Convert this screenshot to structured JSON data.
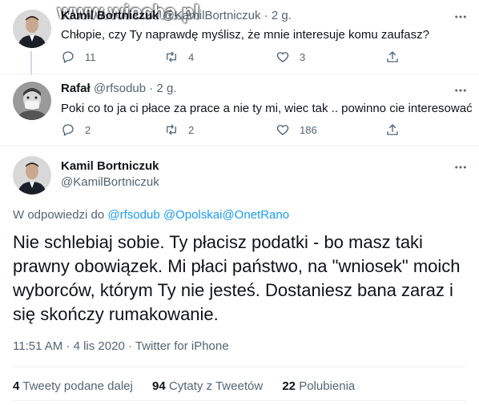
{
  "watermark": "www.wiocha.pl",
  "tweets": [
    {
      "name": "Kamil Bortniczuk",
      "handle": "@KamilBortniczuk",
      "time": "2 g.",
      "text": "Chłopie, czy Ty naprawdę myślisz, że mnie interesuje komu zaufasz?",
      "replies": "11",
      "retweets": "4",
      "likes": "3"
    },
    {
      "name": "Rafał",
      "handle": "@rfsodub",
      "time": "2 g.",
      "text": "Poki co to ja ci płace za prace a nie ty mi, wiec tak .. powinno cie interesować",
      "replies": "2",
      "retweets": "2",
      "likes": "186"
    }
  ],
  "main": {
    "name": "Kamil Bortniczuk",
    "handle": "@KamilBortniczuk",
    "reply_prefix": "W odpowiedzi do",
    "reply_targets": [
      "@rfsodub",
      "@Opolska",
      "i",
      "@OnetRano"
    ],
    "text": "Nie schlebiaj sobie. Ty płacisz podatki - bo masz taki prawny obowiązek. Mi płaci państwo, na \"wniosek\" moich wyborców, którym Ty nie jesteś. Dostaniesz bana zaraz i się skończy rumakowanie.",
    "timestamp": "11:51 AM · 4 lis 2020 · Twitter for iPhone",
    "stats": {
      "retweets_count": "4",
      "retweets_label": "Tweety podane dalej",
      "quotes_count": "94",
      "quotes_label": "Cytaty z Tweetów",
      "likes_count": "22",
      "likes_label": "Polubienia"
    }
  },
  "icons": {
    "reply": "reply-icon",
    "retweet": "retweet-icon",
    "like": "heart-icon",
    "share": "share-icon",
    "more": "more-icon"
  },
  "colors": {
    "link": "#1d9bf0",
    "secondary": "#536471",
    "text": "#0f1419"
  }
}
